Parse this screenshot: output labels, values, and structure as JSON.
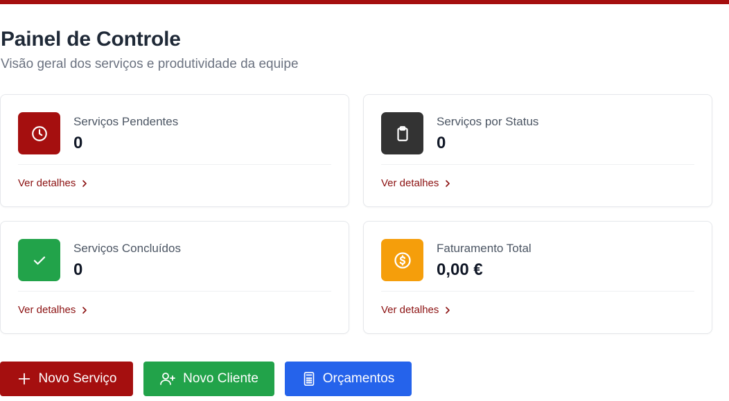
{
  "header": {
    "title": "Painel de Controle",
    "subtitle": "Visão geral dos serviços e produtividade da equipe"
  },
  "cards": [
    {
      "label": "Serviços Pendentes",
      "value": "0",
      "link": "Ver detalhes",
      "icon": "clock-icon",
      "color": "#a50f0f"
    },
    {
      "label": "Serviços por Status",
      "value": "0",
      "link": "Ver detalhes",
      "icon": "clipboard-icon",
      "color": "#333333"
    },
    {
      "label": "Serviços Concluídos",
      "value": "0",
      "link": "Ver detalhes",
      "icon": "check-icon",
      "color": "#22a34a"
    },
    {
      "label": "Faturamento Total",
      "value": "0,00 €",
      "link": "Ver detalhes",
      "icon": "dollar-circle-icon",
      "color": "#f59e0b"
    }
  ],
  "actions": [
    {
      "label": "Novo Serviço",
      "icon": "plus-icon",
      "color": "#a50f0f"
    },
    {
      "label": "Novo Cliente",
      "icon": "user-plus-icon",
      "color": "#22a34a"
    },
    {
      "label": "Orçamentos",
      "icon": "calculator-icon",
      "color": "#2563eb"
    }
  ],
  "colors": {
    "brand": "#a50f0f",
    "link": "#8b1010"
  }
}
